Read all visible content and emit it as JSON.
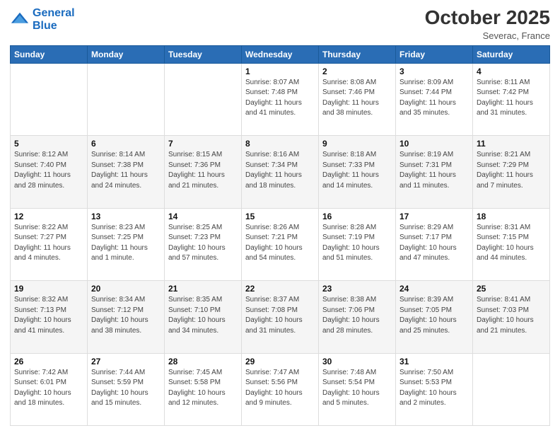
{
  "logo": {
    "line1": "General",
    "line2": "Blue"
  },
  "header": {
    "month_year": "October 2025",
    "location": "Severac, France"
  },
  "weekdays": [
    "Sunday",
    "Monday",
    "Tuesday",
    "Wednesday",
    "Thursday",
    "Friday",
    "Saturday"
  ],
  "weeks": [
    [
      {
        "day": "",
        "info": ""
      },
      {
        "day": "",
        "info": ""
      },
      {
        "day": "",
        "info": ""
      },
      {
        "day": "1",
        "info": "Sunrise: 8:07 AM\nSunset: 7:48 PM\nDaylight: 11 hours\nand 41 minutes."
      },
      {
        "day": "2",
        "info": "Sunrise: 8:08 AM\nSunset: 7:46 PM\nDaylight: 11 hours\nand 38 minutes."
      },
      {
        "day": "3",
        "info": "Sunrise: 8:09 AM\nSunset: 7:44 PM\nDaylight: 11 hours\nand 35 minutes."
      },
      {
        "day": "4",
        "info": "Sunrise: 8:11 AM\nSunset: 7:42 PM\nDaylight: 11 hours\nand 31 minutes."
      }
    ],
    [
      {
        "day": "5",
        "info": "Sunrise: 8:12 AM\nSunset: 7:40 PM\nDaylight: 11 hours\nand 28 minutes."
      },
      {
        "day": "6",
        "info": "Sunrise: 8:14 AM\nSunset: 7:38 PM\nDaylight: 11 hours\nand 24 minutes."
      },
      {
        "day": "7",
        "info": "Sunrise: 8:15 AM\nSunset: 7:36 PM\nDaylight: 11 hours\nand 21 minutes."
      },
      {
        "day": "8",
        "info": "Sunrise: 8:16 AM\nSunset: 7:34 PM\nDaylight: 11 hours\nand 18 minutes."
      },
      {
        "day": "9",
        "info": "Sunrise: 8:18 AM\nSunset: 7:33 PM\nDaylight: 11 hours\nand 14 minutes."
      },
      {
        "day": "10",
        "info": "Sunrise: 8:19 AM\nSunset: 7:31 PM\nDaylight: 11 hours\nand 11 minutes."
      },
      {
        "day": "11",
        "info": "Sunrise: 8:21 AM\nSunset: 7:29 PM\nDaylight: 11 hours\nand 7 minutes."
      }
    ],
    [
      {
        "day": "12",
        "info": "Sunrise: 8:22 AM\nSunset: 7:27 PM\nDaylight: 11 hours\nand 4 minutes."
      },
      {
        "day": "13",
        "info": "Sunrise: 8:23 AM\nSunset: 7:25 PM\nDaylight: 11 hours\nand 1 minute."
      },
      {
        "day": "14",
        "info": "Sunrise: 8:25 AM\nSunset: 7:23 PM\nDaylight: 10 hours\nand 57 minutes."
      },
      {
        "day": "15",
        "info": "Sunrise: 8:26 AM\nSunset: 7:21 PM\nDaylight: 10 hours\nand 54 minutes."
      },
      {
        "day": "16",
        "info": "Sunrise: 8:28 AM\nSunset: 7:19 PM\nDaylight: 10 hours\nand 51 minutes."
      },
      {
        "day": "17",
        "info": "Sunrise: 8:29 AM\nSunset: 7:17 PM\nDaylight: 10 hours\nand 47 minutes."
      },
      {
        "day": "18",
        "info": "Sunrise: 8:31 AM\nSunset: 7:15 PM\nDaylight: 10 hours\nand 44 minutes."
      }
    ],
    [
      {
        "day": "19",
        "info": "Sunrise: 8:32 AM\nSunset: 7:13 PM\nDaylight: 10 hours\nand 41 minutes."
      },
      {
        "day": "20",
        "info": "Sunrise: 8:34 AM\nSunset: 7:12 PM\nDaylight: 10 hours\nand 38 minutes."
      },
      {
        "day": "21",
        "info": "Sunrise: 8:35 AM\nSunset: 7:10 PM\nDaylight: 10 hours\nand 34 minutes."
      },
      {
        "day": "22",
        "info": "Sunrise: 8:37 AM\nSunset: 7:08 PM\nDaylight: 10 hours\nand 31 minutes."
      },
      {
        "day": "23",
        "info": "Sunrise: 8:38 AM\nSunset: 7:06 PM\nDaylight: 10 hours\nand 28 minutes."
      },
      {
        "day": "24",
        "info": "Sunrise: 8:39 AM\nSunset: 7:05 PM\nDaylight: 10 hours\nand 25 minutes."
      },
      {
        "day": "25",
        "info": "Sunrise: 8:41 AM\nSunset: 7:03 PM\nDaylight: 10 hours\nand 21 minutes."
      }
    ],
    [
      {
        "day": "26",
        "info": "Sunrise: 7:42 AM\nSunset: 6:01 PM\nDaylight: 10 hours\nand 18 minutes."
      },
      {
        "day": "27",
        "info": "Sunrise: 7:44 AM\nSunset: 5:59 PM\nDaylight: 10 hours\nand 15 minutes."
      },
      {
        "day": "28",
        "info": "Sunrise: 7:45 AM\nSunset: 5:58 PM\nDaylight: 10 hours\nand 12 minutes."
      },
      {
        "day": "29",
        "info": "Sunrise: 7:47 AM\nSunset: 5:56 PM\nDaylight: 10 hours\nand 9 minutes."
      },
      {
        "day": "30",
        "info": "Sunrise: 7:48 AM\nSunset: 5:54 PM\nDaylight: 10 hours\nand 5 minutes."
      },
      {
        "day": "31",
        "info": "Sunrise: 7:50 AM\nSunset: 5:53 PM\nDaylight: 10 hours\nand 2 minutes."
      },
      {
        "day": "",
        "info": ""
      }
    ]
  ]
}
